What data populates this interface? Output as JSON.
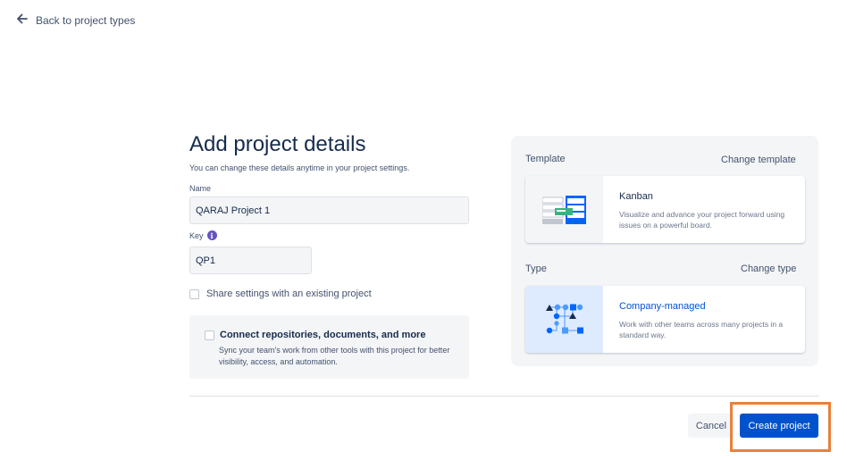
{
  "nav": {
    "back_label": "Back to project types"
  },
  "form": {
    "title": "Add project details",
    "subtitle": "You can change these details anytime in your project settings.",
    "name_label": "Name",
    "name_value": "QARAJ Project 1",
    "key_label": "Key",
    "key_value": "QP1",
    "share_label": "Share settings with an existing project",
    "connect_title": "Connect repositories, documents, and more",
    "connect_description": "Sync your team's work from other tools with this project for better visibility, access, and automation."
  },
  "template": {
    "section_label": "Template",
    "change_label": "Change template",
    "name": "Kanban",
    "description": "Visualize and advance your project forward using issues on a powerful board."
  },
  "type": {
    "section_label": "Type",
    "change_label": "Change type",
    "name": "Company-managed",
    "description": "Work with other teams across many projects in a standard way."
  },
  "footer": {
    "cancel_label": "Cancel",
    "create_label": "Create project"
  },
  "colors": {
    "primary": "#0052cc",
    "highlight": "#e8813c",
    "info": "#6554c0"
  },
  "icons": [
    "arrow-left-icon",
    "info-icon",
    "kanban-board-icon",
    "company-managed-icon"
  ]
}
